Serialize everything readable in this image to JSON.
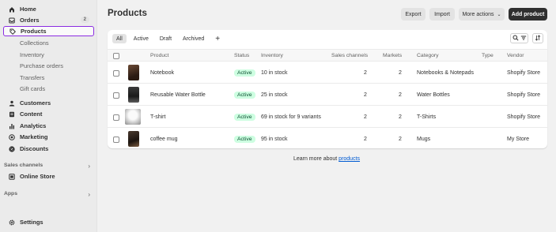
{
  "sidebar": {
    "items": [
      {
        "label": "Home",
        "icon": "home-icon"
      },
      {
        "label": "Orders",
        "icon": "inbox-icon",
        "badge": "2"
      },
      {
        "label": "Products",
        "icon": "tag-icon"
      },
      {
        "label": "Collections"
      },
      {
        "label": "Inventory"
      },
      {
        "label": "Purchase orders"
      },
      {
        "label": "Transfers"
      },
      {
        "label": "Gift cards"
      },
      {
        "label": "Customers",
        "icon": "person-icon"
      },
      {
        "label": "Content",
        "icon": "document-icon"
      },
      {
        "label": "Analytics",
        "icon": "bar-chart-icon"
      },
      {
        "label": "Marketing",
        "icon": "target-icon"
      },
      {
        "label": "Discounts",
        "icon": "discount-icon"
      }
    ],
    "sales_channels_label": "Sales channels",
    "online_store_label": "Online Store",
    "apps_label": "Apps",
    "settings_label": "Settings"
  },
  "header": {
    "title": "Products",
    "export_label": "Export",
    "import_label": "Import",
    "more_actions_label": "More actions",
    "add_product_label": "Add product"
  },
  "tabs": [
    "All",
    "Active",
    "Draft",
    "Archived"
  ],
  "table": {
    "columns": [
      "Product",
      "Status",
      "Inventory",
      "Sales channels",
      "Markets",
      "Category",
      "Type",
      "Vendor"
    ],
    "rows": [
      {
        "product": "Notebook",
        "status": "Active",
        "inventory": "10 in stock",
        "sales_channels": "2",
        "markets": "2",
        "category": "Notebooks & Notepads",
        "type": "",
        "vendor": "Shopify Store"
      },
      {
        "product": "Reusable Water Bottle",
        "status": "Active",
        "inventory": "25 in stock",
        "sales_channels": "2",
        "markets": "2",
        "category": "Water Bottles",
        "type": "",
        "vendor": "Shopify Store"
      },
      {
        "product": "T-shirt",
        "status": "Active",
        "inventory": "69 in stock for 9 variants",
        "sales_channels": "2",
        "markets": "2",
        "category": "T-Shirts",
        "type": "",
        "vendor": "Shopify Store"
      },
      {
        "product": "coffee mug",
        "status": "Active",
        "inventory": "95 in stock",
        "sales_channels": "2",
        "markets": "2",
        "category": "Mugs",
        "type": "",
        "vendor": "My Store"
      }
    ]
  },
  "footer": {
    "learn_more_prefix": "Learn more about",
    "learn_more_link": "products"
  },
  "colors": {
    "accent_outline": "#8a2be2",
    "primary_button": "#303030",
    "status_active_bg": "#cdfee1",
    "link": "#005bd3"
  }
}
